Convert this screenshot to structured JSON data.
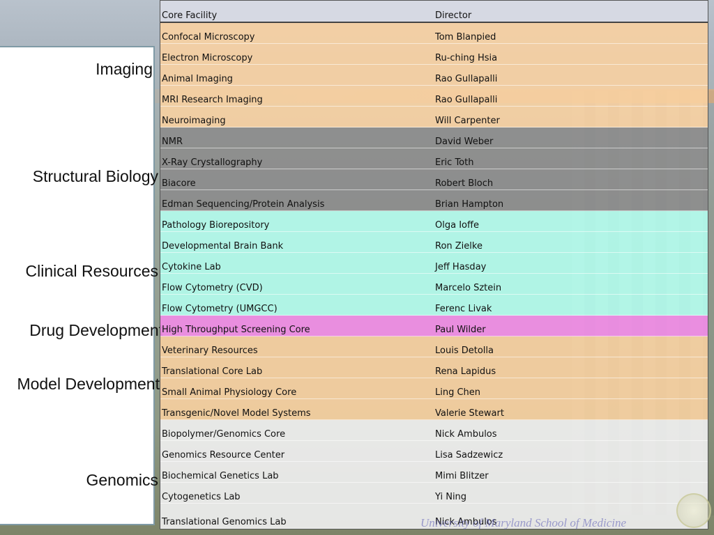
{
  "categories": {
    "imaging": "Imaging",
    "structural": "Structural Biology",
    "clinical": "Clinical Resources",
    "drug": "Drug Development",
    "model": "Model Development",
    "genomics": "Genomics"
  },
  "table": {
    "header": {
      "facility": "Core Facility",
      "director": "Director"
    },
    "rows": [
      {
        "facility": "Confocal Microscopy",
        "director": "Tom Blanpied"
      },
      {
        "facility": "Electron Microscopy",
        "director": "Ru-ching Hsia"
      },
      {
        "facility": "Animal Imaging",
        "director": "Rao Gullapalli"
      },
      {
        "facility": "MRI Research Imaging",
        "director": "Rao Gullapalli"
      },
      {
        "facility": "Neuroimaging",
        "director": "Will Carpenter"
      },
      {
        "facility": "NMR",
        "director": "David Weber"
      },
      {
        "facility": "X-Ray Crystallography",
        "director": "Eric Toth"
      },
      {
        "facility": "Biacore",
        "director": "Robert Bloch"
      },
      {
        "facility": "Edman Sequencing/Protein Analysis",
        "director": "Brian Hampton"
      },
      {
        "facility": "Pathology Biorepository",
        "director": "Olga Ioffe"
      },
      {
        "facility": "Developmental Brain Bank",
        "director": "Ron Zielke"
      },
      {
        "facility": "Cytokine Lab",
        "director": "Jeff Hasday"
      },
      {
        "facility": "Flow Cytometry (CVD)",
        "director": "Marcelo Sztein"
      },
      {
        "facility": "Flow Cytometry (UMGCC)",
        "director": "Ferenc Livak"
      },
      {
        "facility": "High Throughput Screening Core",
        "director": "Paul Wilder"
      },
      {
        "facility": "Veterinary Resources",
        "director": "Louis Detolla"
      },
      {
        "facility": "Translational Core Lab",
        "director": "Rena Lapidus"
      },
      {
        "facility": "Small Animal Physiology Core",
        "director": "Ling Chen"
      },
      {
        "facility": "Transgenic/Novel Model Systems",
        "director": "Valerie Stewart"
      },
      {
        "facility": "Biopolymer/Genomics Core",
        "director": "Nick Ambulos"
      },
      {
        "facility": "Genomics Resource Center",
        "director": "Lisa Sadzewicz"
      },
      {
        "facility": "Biochemical Genetics Lab",
        "director": "Mimi Blitzer"
      },
      {
        "facility": "Cytogenetics Lab",
        "director": "Yi Ning"
      },
      {
        "facility": "Translational Genomics Lab",
        "director": "Nick Ambulos"
      }
    ]
  },
  "footer": {
    "text": "University of Maryland School of Medicine"
  },
  "colors": {
    "imaging": "#fad2a0",
    "structural": "#8c8c8c",
    "clinical": "#b4fff0",
    "drug": "#f08ce6",
    "model": "#fad2a0",
    "genomics": "#eeeeee"
  }
}
